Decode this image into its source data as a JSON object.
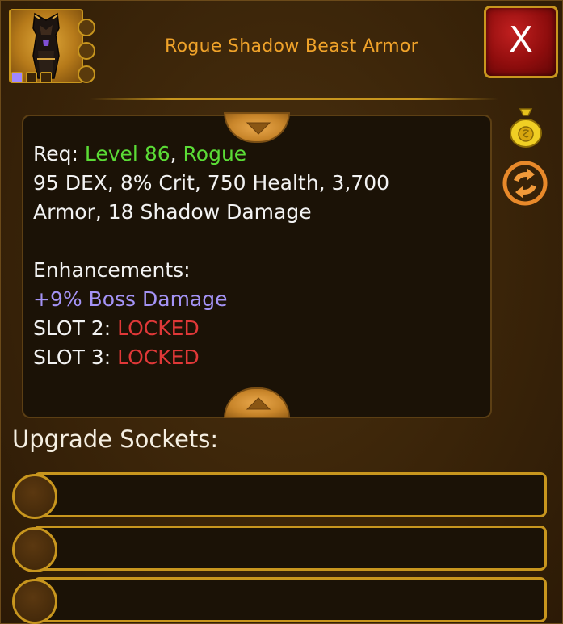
{
  "item": {
    "name": "Rogue Shadow Beast Armor",
    "icon": "shadow-armor-icon"
  },
  "close_label": "X",
  "stats": {
    "req_prefix": "Req: ",
    "req_level": "Level 86",
    "req_sep": ", ",
    "req_class": "Rogue",
    "line2": "95 DEX, 8% Crit, 750 Health, 3,700",
    "line3": "Armor, 18 Shadow Damage",
    "enhancements_header": "Enhancements:",
    "enhancement1": "+9% Boss Damage",
    "slot2_label": "SLOT 2: ",
    "slot2_status": "LOCKED",
    "slot3_label": "SLOT 3: ",
    "slot3_status": "LOCKED"
  },
  "sockets": {
    "label": "Upgrade Sockets:",
    "rows": 3
  },
  "colors": {
    "title": "#f0a32a",
    "requirement": "#5bdc36",
    "enhancement": "#a493f5",
    "locked": "#e03838",
    "frame_gold": "#c8961e"
  }
}
